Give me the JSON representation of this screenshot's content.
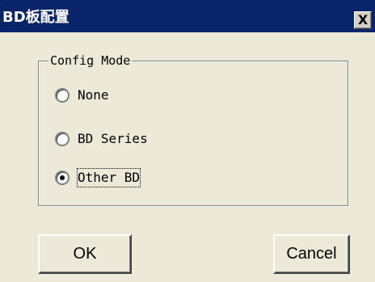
{
  "window": {
    "title": "BD板配置",
    "close_label": "X"
  },
  "config_mode": {
    "legend": "Config Mode",
    "options": [
      {
        "label": "None",
        "selected": false
      },
      {
        "label": "BD Series",
        "selected": false
      },
      {
        "label": "Other BD",
        "selected": true
      }
    ]
  },
  "buttons": {
    "ok_label": "OK",
    "cancel_label": "Cancel"
  },
  "colors": {
    "titlebar": "#0a246a",
    "face": "#ece9d8"
  }
}
